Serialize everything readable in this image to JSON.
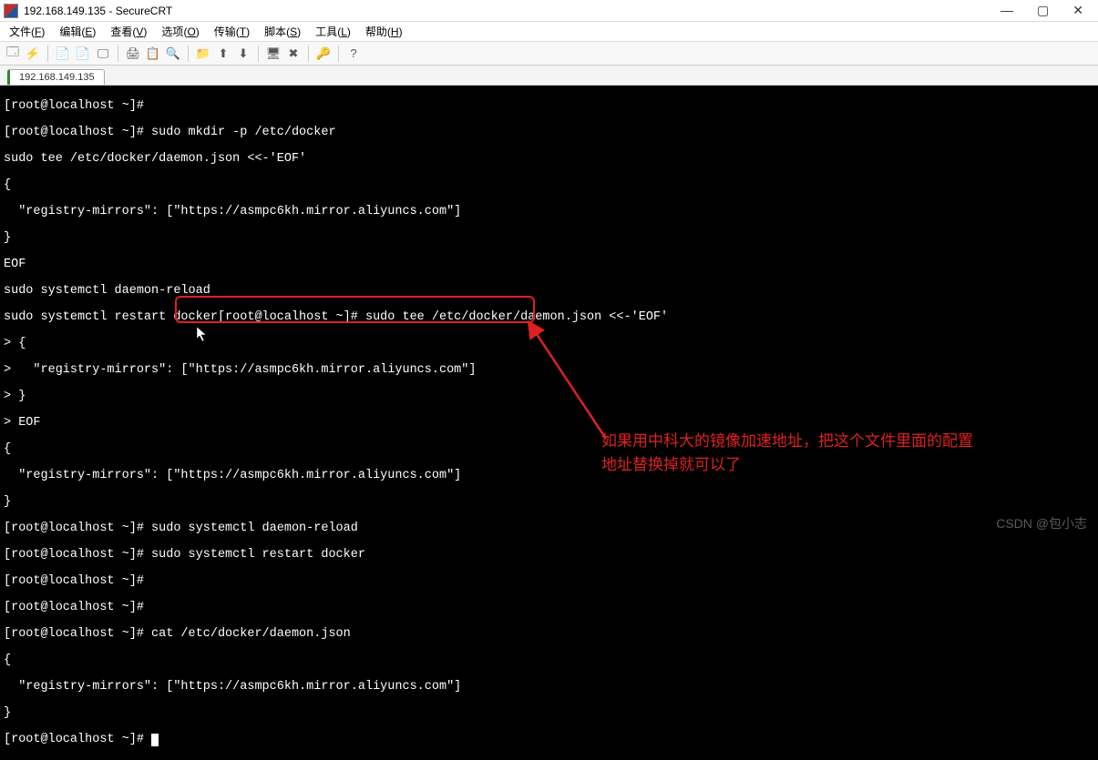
{
  "window": {
    "title": "192.168.149.135 - SecureCRT",
    "controls": {
      "min": "—",
      "max": "▢",
      "close": "✕"
    }
  },
  "menu": {
    "items": [
      {
        "label": "文件",
        "key": "F"
      },
      {
        "label": "编辑",
        "key": "E"
      },
      {
        "label": "查看",
        "key": "V"
      },
      {
        "label": "选项",
        "key": "O"
      },
      {
        "label": "传输",
        "key": "T"
      },
      {
        "label": "脚本",
        "key": "S"
      },
      {
        "label": "工具",
        "key": "L"
      },
      {
        "label": "帮助",
        "key": "H"
      }
    ]
  },
  "toolbar": {
    "icons": [
      "🗔",
      "⚡",
      "|",
      "📄",
      "📄",
      "🖵",
      "|",
      "🖨",
      "📋",
      "🔍",
      "|",
      "📁",
      "⬆",
      "⬇",
      "|",
      "🖥",
      "✖",
      "|",
      "🔑",
      "|",
      "?"
    ]
  },
  "tab": {
    "label": "192.168.149.135"
  },
  "terminal": {
    "lines": [
      "[root@localhost ~]# ",
      "[root@localhost ~]# sudo mkdir -p /etc/docker",
      "sudo tee /etc/docker/daemon.json <<-'EOF'",
      "{",
      "  \"registry-mirrors\": [\"https://asmpc6kh.mirror.aliyuncs.com\"]",
      "}",
      "EOF",
      "sudo systemctl daemon-reload",
      "sudo systemctl restart docker[root@localhost ~]# sudo tee /etc/docker/daemon.json <<-'EOF'",
      "> {",
      ">   \"registry-mirrors\": [\"https://asmpc6kh.mirror.aliyuncs.com\"]",
      "> }",
      "> EOF",
      "{",
      "  \"registry-mirrors\": [\"https://asmpc6kh.mirror.aliyuncs.com\"]",
      "}",
      "[root@localhost ~]# sudo systemctl daemon-reload",
      "[root@localhost ~]# sudo systemctl restart docker",
      "[root@localhost ~]# ",
      "[root@localhost ~]# ",
      "[root@localhost ~]# cat /etc/docker/daemon.json",
      "{",
      "  \"registry-mirrors\": [\"https://asmpc6kh.mirror.aliyuncs.com\"]",
      "}",
      "[root@localhost ~]# "
    ]
  },
  "annotation": {
    "text_line1": "如果用中科大的镜像加速地址，把这个文件里面的配置",
    "text_line2": "地址替换掉就可以了"
  },
  "watermark": "CSDN @包小志"
}
